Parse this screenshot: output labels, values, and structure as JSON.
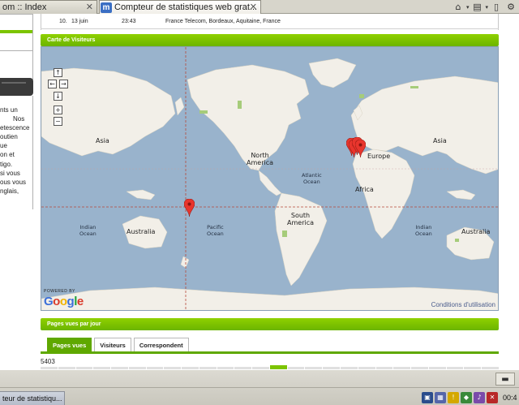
{
  "browser": {
    "tabs": [
      {
        "label": "om :: Index",
        "close": "✕"
      },
      {
        "label": "Compteur de statistiques web grat...",
        "icon": "m",
        "close": "✕"
      }
    ],
    "toolbar_icons": [
      "home-icon",
      "print-icon",
      "page-icon",
      "tools-icon"
    ]
  },
  "sidebar": {
    "text_lines": [
      "nts un",
      "Nos",
      "etescence",
      "outien",
      "ue",
      "on et",
      "tigo.",
      "si vous",
      "ous vous",
      "nglais,"
    ]
  },
  "visit_row": {
    "index": "10.",
    "date": "13 juin",
    "time": "23:43",
    "location": "France Telecom, Bordeaux, Aquitaine, France"
  },
  "map_section": {
    "title": "Carte de Visiteurs",
    "controls": {
      "up": "↑",
      "left": "←",
      "right": "→",
      "down": "↓",
      "zoom_in": "+",
      "zoom_out": "−"
    },
    "labels": [
      {
        "text": "Asia",
        "kind": "continent"
      },
      {
        "text": "North\nAmerica",
        "kind": "continent"
      },
      {
        "text": "Atlantic\nOcean",
        "kind": "ocean"
      },
      {
        "text": "Europe",
        "kind": "continent"
      },
      {
        "text": "Asia",
        "kind": "continent"
      },
      {
        "text": "Africa",
        "kind": "continent"
      },
      {
        "text": "Indian\nOcean",
        "kind": "ocean"
      },
      {
        "text": "Australia",
        "kind": "continent"
      },
      {
        "text": "Pacific\nOcean",
        "kind": "ocean"
      },
      {
        "text": "South\nAmerica",
        "kind": "continent"
      },
      {
        "text": "Indian\nOcean",
        "kind": "ocean"
      },
      {
        "text": "Australia",
        "kind": "continent"
      }
    ],
    "powered_by": "POWERED BY",
    "logo_letters": [
      {
        "ch": "G",
        "color": "#3b6fd9"
      },
      {
        "ch": "o",
        "color": "#d93b2b"
      },
      {
        "ch": "o",
        "color": "#f0b400"
      },
      {
        "ch": "g",
        "color": "#3b6fd9"
      },
      {
        "ch": "l",
        "color": "#1fa23a"
      },
      {
        "ch": "e",
        "color": "#d93b2b"
      }
    ],
    "terms": "Conditions d'utilisation",
    "marker_count": 5,
    "colors": {
      "ocean": "#99b3cc",
      "land": "#f2efe8",
      "marker": "#e8352d"
    }
  },
  "views_section": {
    "title": "Pages vues par jour",
    "tabs": [
      {
        "label": "Pages vues",
        "active": true
      },
      {
        "label": "Visiteurs",
        "active": false
      },
      {
        "label": "Correspondent",
        "active": false
      }
    ],
    "max_value": "5403",
    "bar_count": 26,
    "highlighted_bar": 13
  },
  "taskbar": {
    "minimize": "▬",
    "task_label": "teur de statistiqu...",
    "clock": "00:4"
  }
}
